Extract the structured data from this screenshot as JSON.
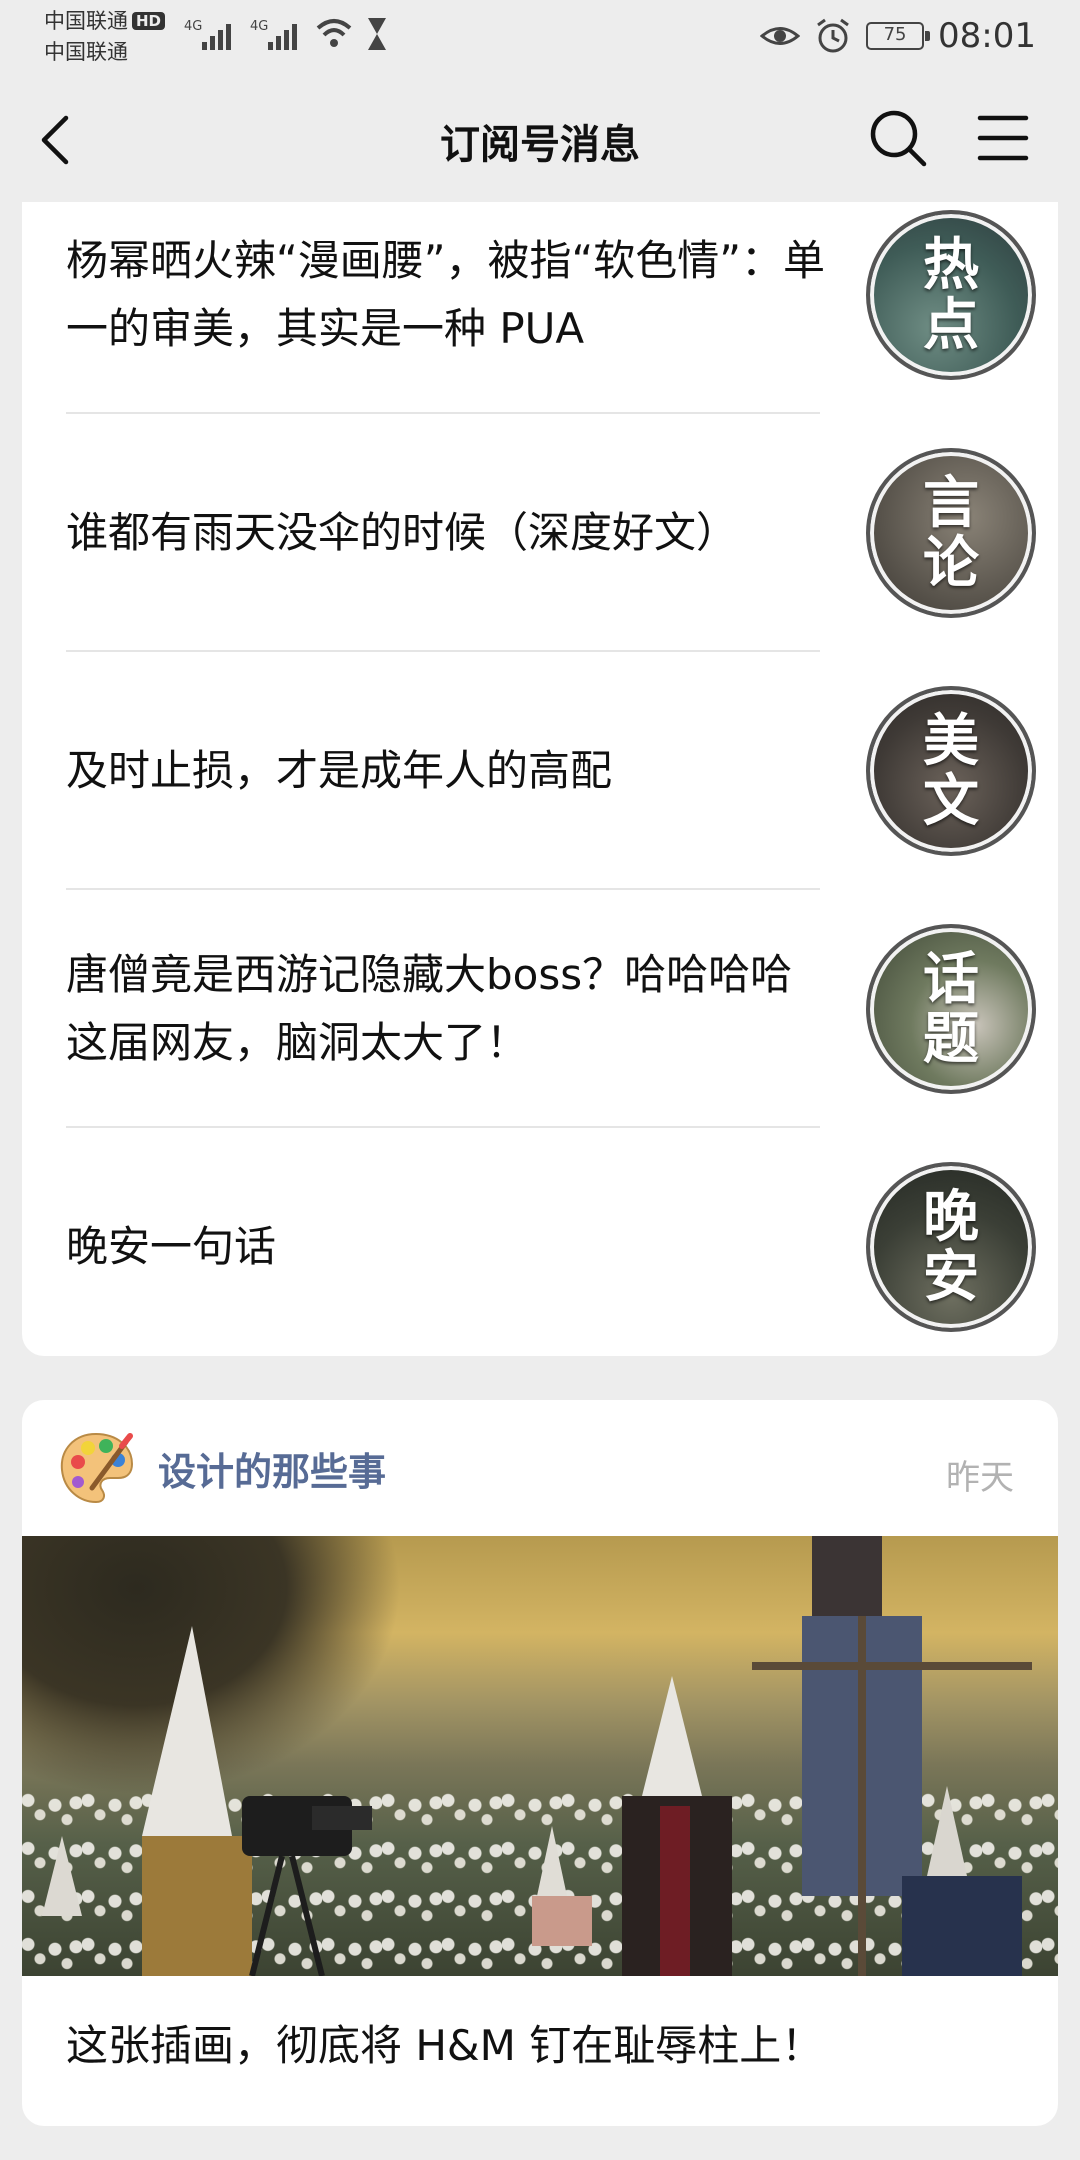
{
  "status_bar": {
    "carrier1": "中国联通",
    "hd_badge": "HD",
    "carrier2": "中国联通",
    "network1": "4G",
    "network2": "4G",
    "battery": "75",
    "time": "08:01"
  },
  "nav": {
    "title": "订阅号消息",
    "icons": [
      "back-icon",
      "search-icon",
      "menu-icon"
    ]
  },
  "articles": [
    {
      "title": "杨幂晒火辣“漫画腰”，被指“软色情”：单一的审美，其实是一种 PUA",
      "thumb_line1": "热",
      "thumb_line2": "点"
    },
    {
      "title": "谁都有雨天没伞的时候（深度好文）",
      "thumb_line1": "言",
      "thumb_line2": "论"
    },
    {
      "title": "及时止损，才是成年人的高配",
      "thumb_line1": "美",
      "thumb_line2": "文"
    },
    {
      "title": "唐僧竟是西游记隐藏大boss？哈哈哈哈这届网友，脑洞太大了！",
      "thumb_line1": "话",
      "thumb_line2": "题"
    },
    {
      "title": "晚安一句话",
      "thumb_line1": "晚",
      "thumb_line2": "安"
    }
  ],
  "card2": {
    "account_name": "设计的那些事",
    "time": "昨天",
    "post_title": "这张插画，彻底将 H&M 钉在耻辱柱上！"
  },
  "colors": {
    "background": "#ededed",
    "card": "#ffffff",
    "account_name": "#576b95",
    "meta": "#b2b2b2"
  }
}
